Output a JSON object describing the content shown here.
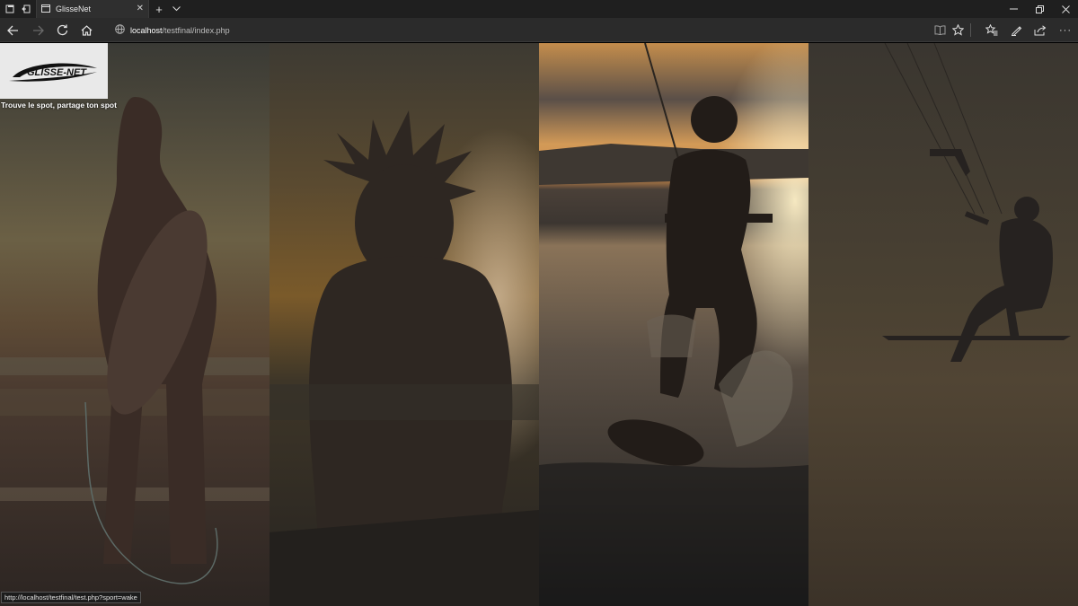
{
  "browser": {
    "tab_title": "GlisseNet",
    "tab_close": "✕",
    "new_tab": "+",
    "tab_list": "⌄",
    "window": {
      "minimize": "—",
      "restore": "❐",
      "close": "✕"
    },
    "address_host": "localhost",
    "address_path": "/testfinal/index.php",
    "status_url": "http://localhost/testfinal/test.php?sport=wake",
    "more": "···"
  },
  "page": {
    "logo_text": "GLISSE-NET",
    "tagline": "Trouve le spot, partage ton spot",
    "panels": [
      {
        "sport": "surf"
      },
      {
        "sport": "paddle"
      },
      {
        "sport": "wake"
      },
      {
        "sport": "kite"
      }
    ]
  },
  "colors": {
    "titlebar": "#1f1f1f",
    "addressbar": "#2b2b2b",
    "sunset_orange": "#c98a3a",
    "dark_overlay": "#2a2620"
  }
}
